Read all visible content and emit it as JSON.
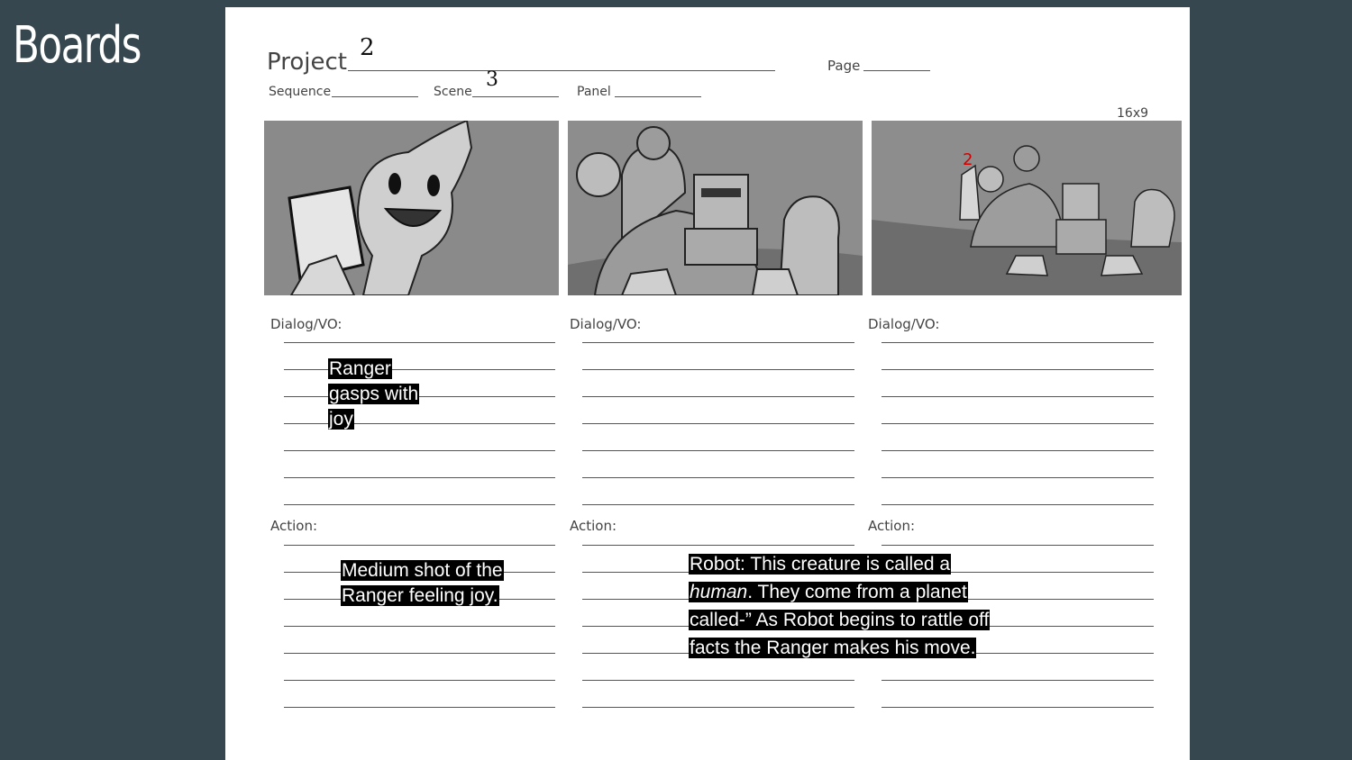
{
  "slide": {
    "title": "Boards"
  },
  "sheet": {
    "project_label": "Project",
    "project_value": "2",
    "page_label": "Page",
    "sequence_label": "Sequence",
    "scene_label": "Scene",
    "scene_value": "3",
    "panel_label": "Panel",
    "aspect_label": "16x9",
    "panels": [
      {
        "dialog_label": "Dialog/VO:",
        "action_label": "Action:",
        "dialog_note": "Ranger gasps with joy",
        "action_note": "Medium shot of the Ranger feeling joy."
      },
      {
        "dialog_label": "Dialog/VO:",
        "action_label": "Action:",
        "action_note_pre": "Robot: This creature is called a ",
        "action_note_em": "human",
        "action_note_post": ". They come from a planet called-” As Robot begins to rattle off facts the Ranger makes his move."
      },
      {
        "dialog_label": "Dialog/VO:",
        "action_label": "Action:",
        "sketch_mark": "2"
      }
    ]
  }
}
